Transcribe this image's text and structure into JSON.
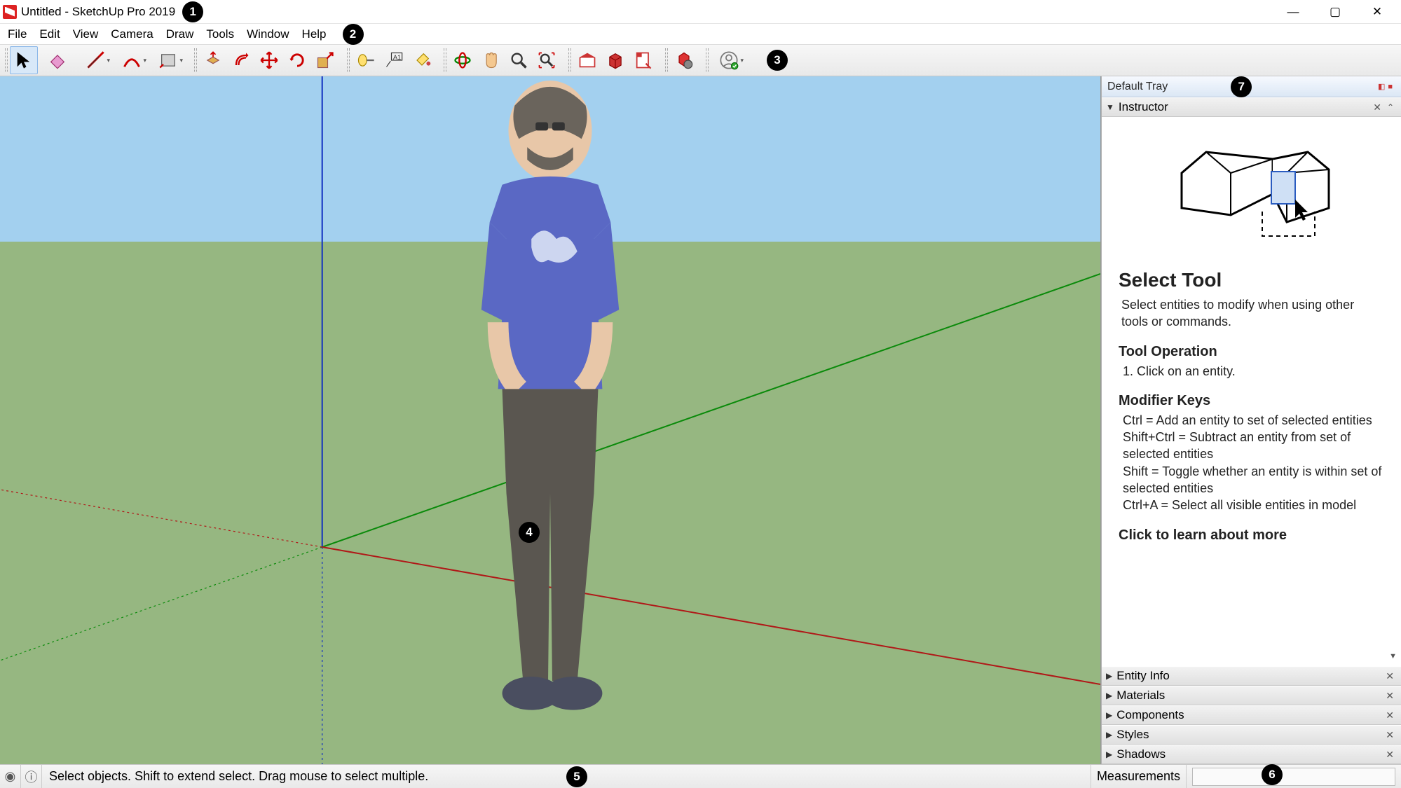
{
  "window": {
    "title": "Untitled - SketchUp Pro 2019",
    "minimize": "—",
    "maximize": "▢",
    "close": "✕"
  },
  "menu": [
    "File",
    "Edit",
    "View",
    "Camera",
    "Draw",
    "Tools",
    "Window",
    "Help"
  ],
  "status": {
    "hint": "Select objects. Shift to extend select. Drag mouse to select multiple.",
    "measurements_label": "Measurements"
  },
  "tray": {
    "title": "Default Tray",
    "panels": {
      "instructor": "Instructor",
      "entity": "Entity Info",
      "materials": "Materials",
      "components": "Components",
      "styles": "Styles",
      "shadows": "Shadows"
    }
  },
  "instructor": {
    "title": "Select Tool",
    "desc": "Select entities to modify when using other tools or commands.",
    "op_head": "Tool Operation",
    "op_line": "1. Click on an entity.",
    "mod_head": "Modifier Keys",
    "mod_ctrl": "Ctrl = Add an entity to set of selected entities",
    "mod_shiftctrl": "Shift+Ctrl = Subtract an entity from set of selected entities",
    "mod_shift": "Shift = Toggle whether an entity is within set of selected entities",
    "mod_ctrla": "Ctrl+A = Select all visible entities in model",
    "more": "Click to learn about more"
  },
  "callouts": [
    "1",
    "2",
    "3",
    "4",
    "5",
    "6",
    "7"
  ]
}
